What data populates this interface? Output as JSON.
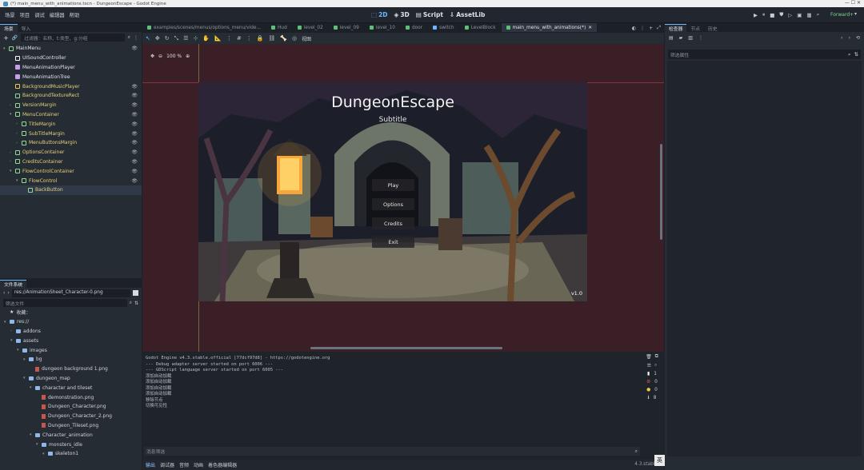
{
  "titlebar": {
    "title": "(*) main_menu_with_animations.tscn - DungeonEscape - Godot Engine"
  },
  "menu": [
    "场景",
    "项目",
    "调试",
    "编辑器",
    "帮助"
  ],
  "workspaces": {
    "w2d": "2D",
    "w3d": "3D",
    "script": "Script",
    "assetlib": "AssetLib"
  },
  "renderer": "Forward+",
  "scene_dock": {
    "tabs": [
      "场景",
      "导入"
    ],
    "filter_placeholder": "过滤器：名称、t:类型、g:分组",
    "nodes": [
      {
        "name": "MainMenu",
        "indent": 0,
        "color": "#8fdc90"
      },
      {
        "name": "UISoundController",
        "indent": 1,
        "color": "#ffffff"
      },
      {
        "name": "MenuAnimationPlayer",
        "indent": 1,
        "color": "#c79cf2"
      },
      {
        "name": "MenuAnimationTree",
        "indent": 1,
        "color": "#c79cf2"
      },
      {
        "name": "BackgroundMusicPlayer",
        "indent": 1,
        "color": "#f0c94c"
      },
      {
        "name": "BackgroundTextureRect",
        "indent": 1,
        "color": "#8fdc90"
      },
      {
        "name": "VersionMargin",
        "indent": 1,
        "color": "#8fdc90"
      },
      {
        "name": "MenuContainer",
        "indent": 1,
        "color": "#8fdc90"
      },
      {
        "name": "TitleMargin",
        "indent": 2,
        "color": "#8fdc90"
      },
      {
        "name": "SubTitleMargin",
        "indent": 2,
        "color": "#8fdc90"
      },
      {
        "name": "MenuButtonsMargin",
        "indent": 2,
        "color": "#8fdc90"
      },
      {
        "name": "OptionsContainer",
        "indent": 1,
        "color": "#8fdc90"
      },
      {
        "name": "CreditsContainer",
        "indent": 1,
        "color": "#8fdc90"
      },
      {
        "name": "FlowControlContainer",
        "indent": 1,
        "color": "#8fdc90"
      },
      {
        "name": "FlowControl",
        "indent": 2,
        "color": "#8fdc90"
      },
      {
        "name": "BackButton",
        "indent": 3,
        "color": "#8fdc90"
      }
    ]
  },
  "filesystem": {
    "tab": "文件系统",
    "path": "res://AnimationSheet_Character-0.png",
    "filter_placeholder": "筛选文件",
    "items": [
      {
        "name": "收藏：",
        "indent": 0,
        "type": "fav"
      },
      {
        "name": "res://",
        "indent": 0,
        "type": "folder"
      },
      {
        "name": "addons",
        "indent": 1,
        "type": "folder"
      },
      {
        "name": "assets",
        "indent": 1,
        "type": "folder"
      },
      {
        "name": "images",
        "indent": 2,
        "type": "folder"
      },
      {
        "name": "bg",
        "indent": 3,
        "type": "folder"
      },
      {
        "name": "dungeon background 1.png",
        "indent": 4,
        "type": "file"
      },
      {
        "name": "dungeon_map",
        "indent": 3,
        "type": "folder"
      },
      {
        "name": "character and tileset",
        "indent": 4,
        "type": "folder"
      },
      {
        "name": "demonstration.png",
        "indent": 5,
        "type": "file"
      },
      {
        "name": "Dungeon_Character.png",
        "indent": 5,
        "type": "file"
      },
      {
        "name": "Dungeon_Character_2.png",
        "indent": 5,
        "type": "file"
      },
      {
        "name": "Dungeon_Tileset.png",
        "indent": 5,
        "type": "file"
      },
      {
        "name": "Character_animation",
        "indent": 4,
        "type": "folder"
      },
      {
        "name": "monsters_idle",
        "indent": 5,
        "type": "folder"
      },
      {
        "name": "skeleton1",
        "indent": 6,
        "type": "folder"
      }
    ]
  },
  "editor_tabs": [
    {
      "label": "examples/scenes/menus/options_menu/vide...",
      "active": false
    },
    {
      "label": "Hud",
      "active": false
    },
    {
      "label": "level_02",
      "active": false
    },
    {
      "label": "level_09",
      "active": false
    },
    {
      "label": "level_10",
      "active": false
    },
    {
      "label": "door",
      "active": false
    },
    {
      "label": "switch",
      "active": false
    },
    {
      "label": "LevelBlock",
      "active": false
    },
    {
      "label": "main_menu_with_animations(*)",
      "active": true
    }
  ],
  "viewport": {
    "view_menu": "视图",
    "zoom": "100 %",
    "game_title": "DungeonEscape",
    "subtitle": "Subtitle",
    "buttons": [
      "Play",
      "Options",
      "Credits",
      "Exit"
    ],
    "version": "v1.0"
  },
  "output": {
    "lines": [
      "Godot Engine v4.3.stable.official [77dcf97d8] - https://godotengine.org",
      "--- Debug adapter server started on port 6006 ---",
      "--- GDScript language server started on port 6005 ---",
      "添加自动加载",
      "添加自动加载",
      "添加自动加载",
      "添加自动加载",
      "移除节点",
      "切换可见性"
    ],
    "filter_placeholder": "消息筛选",
    "counts": {
      "log": "1",
      "error": "0",
      "warning": "0",
      "info": "8"
    },
    "bottom_tabs": [
      "输出",
      "调试器",
      "音频",
      "动画",
      "着色器编辑器"
    ],
    "version": "4.3.stable"
  },
  "inspector": {
    "tabs": [
      "检查器",
      "节点",
      "历史"
    ],
    "filter_placeholder": "筛选属性"
  },
  "ime": {
    "label": "英"
  }
}
